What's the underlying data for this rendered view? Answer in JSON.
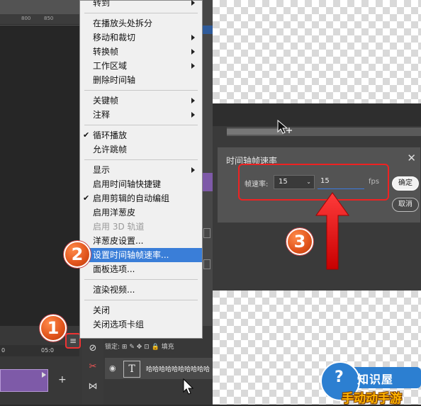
{
  "ruler": {
    "ticks": [
      "800",
      "850"
    ]
  },
  "timeline": {
    "ticks": [
      "0",
      "05:0"
    ]
  },
  "menu": {
    "items": [
      {
        "label": "转到",
        "submenu": true
      },
      {
        "sep": true
      },
      {
        "label": "在播放头处拆分"
      },
      {
        "label": "移动和裁切",
        "submenu": true
      },
      {
        "label": "转换帧",
        "submenu": true
      },
      {
        "label": "工作区域",
        "submenu": true
      },
      {
        "label": "删除时间轴"
      },
      {
        "sep": true
      },
      {
        "label": "关键帧",
        "submenu": true
      },
      {
        "label": "注释",
        "submenu": true
      },
      {
        "sep": true
      },
      {
        "label": "循环播放",
        "checked": true
      },
      {
        "label": "允许跳帧"
      },
      {
        "sep": true
      },
      {
        "label": "显示",
        "submenu": true
      },
      {
        "label": "启用时间轴快捷键"
      },
      {
        "label": "启用剪辑的自动编组",
        "checked": true
      },
      {
        "label": "启用洋葱皮"
      },
      {
        "label": "启用 3D 轨道",
        "disabled": true
      },
      {
        "label": "洋葱皮设置..."
      },
      {
        "label": "设置时间轴帧速率...",
        "highlight": true
      },
      {
        "label": "面板选项..."
      },
      {
        "sep": true
      },
      {
        "label": "渲染视频..."
      },
      {
        "sep": true
      },
      {
        "label": "关闭"
      },
      {
        "label": "关闭选项卡组"
      }
    ]
  },
  "badges": {
    "one": "1",
    "two": "2",
    "three": "3"
  },
  "layers": {
    "lock_label": "锁定:",
    "fill_label": "填充",
    "layer_name": "哈哈哈哈哈哈哈哈哈哈"
  },
  "dialog": {
    "title": "时间轴帧速率",
    "close": "✕",
    "rate_label": "帧速率:",
    "rate_select": "15",
    "rate_input": "15",
    "unit": "fps",
    "ok": "确定",
    "cancel": "取消"
  },
  "watermark": {
    "line1": "知识屋",
    "line2": "手动动手游"
  },
  "colors": {
    "highlight": "#3a7ed8",
    "annotation_red": "#e22222",
    "badge_orange": "#e0531b",
    "clip_purple": "#7e5aa8"
  }
}
